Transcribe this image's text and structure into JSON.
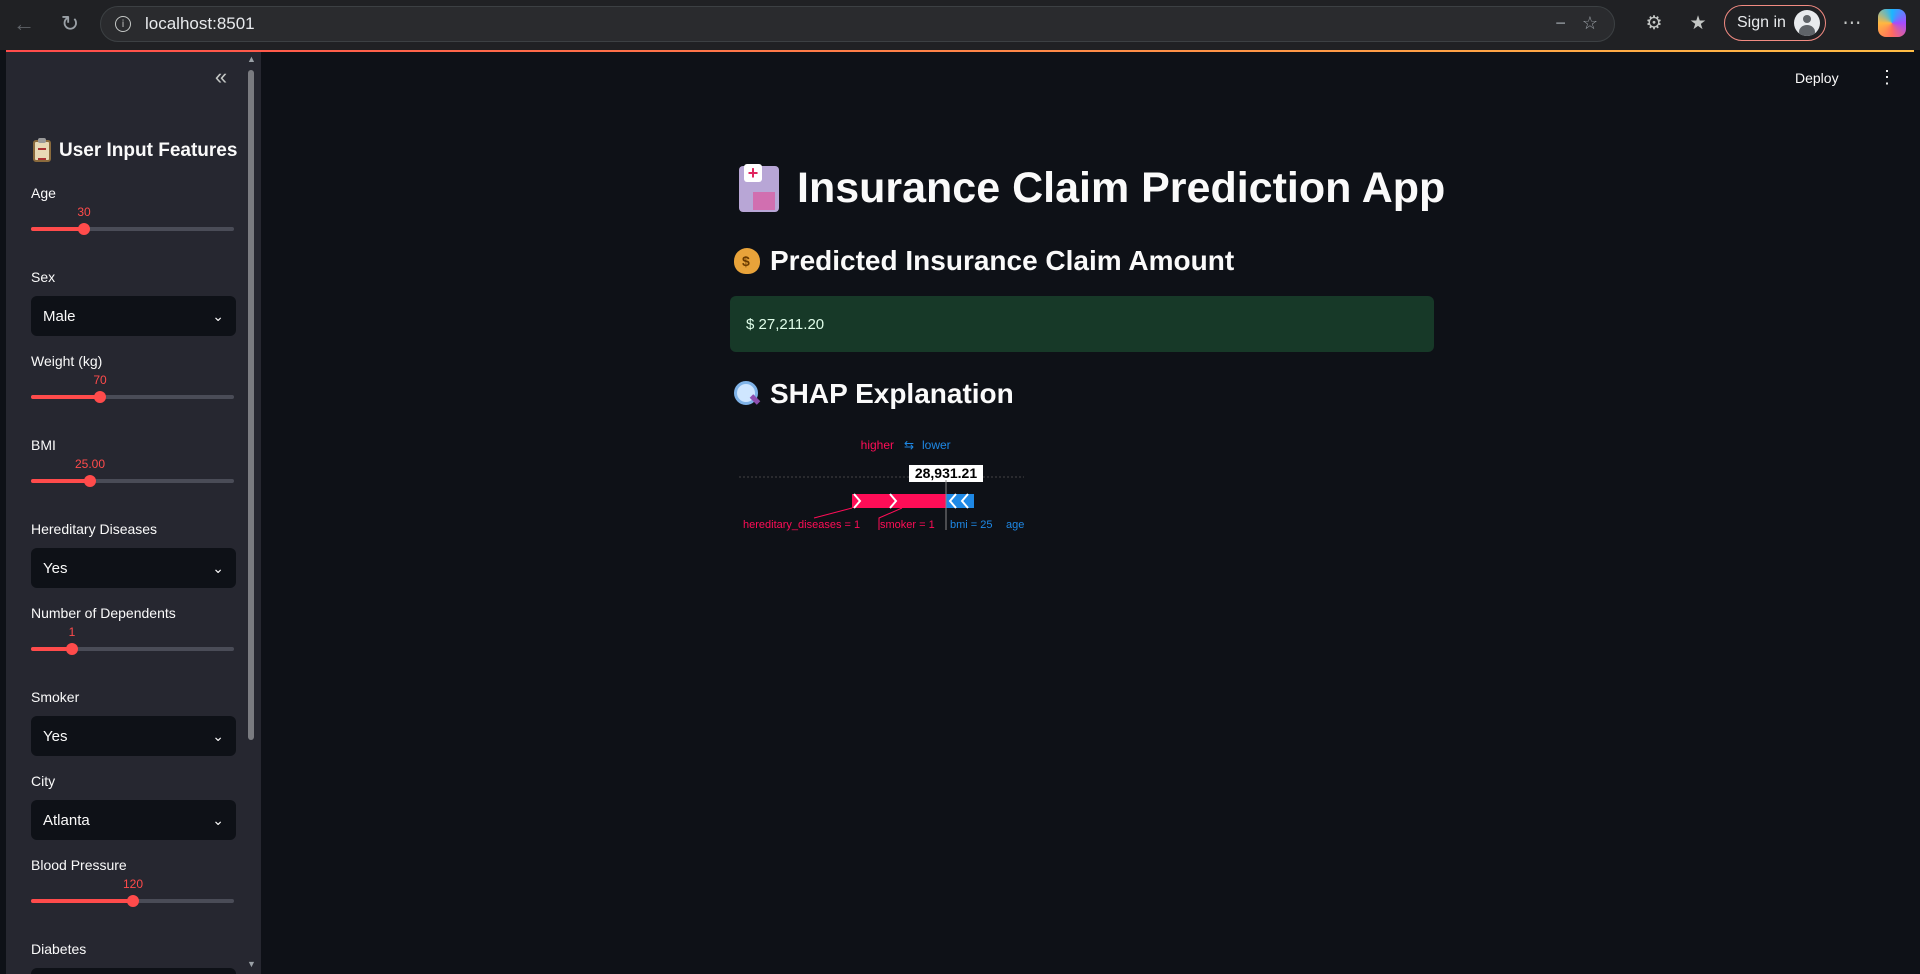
{
  "browser": {
    "url": "localhost:8501",
    "sign_in_label": "Sign in"
  },
  "app": {
    "deploy_label": "Deploy",
    "title": "Insurance Claim Prediction App",
    "prediction_heading": "Predicted Insurance Claim Amount",
    "prediction_value": "$ 27,211.20",
    "shap_heading": "SHAP Explanation"
  },
  "sidebar": {
    "title": "User Input Features",
    "fields": {
      "age": {
        "label": "Age",
        "value": "30",
        "fraction": 0.26
      },
      "sex": {
        "label": "Sex",
        "value": "Male"
      },
      "weight": {
        "label": "Weight (kg)",
        "value": "70",
        "fraction": 0.34
      },
      "bmi": {
        "label": "BMI",
        "value": "25.00",
        "fraction": 0.29
      },
      "hereditary": {
        "label": "Hereditary Diseases",
        "value": "Yes"
      },
      "dependents": {
        "label": "Number of Dependents",
        "value": "1",
        "fraction": 0.2
      },
      "smoker": {
        "label": "Smoker",
        "value": "Yes"
      },
      "city": {
        "label": "City",
        "value": "Atlanta"
      },
      "bp": {
        "label": "Blood Pressure",
        "value": "120",
        "fraction": 0.5
      },
      "diabetes": {
        "label": "Diabetes"
      }
    }
  },
  "shap": {
    "higher_label": "higher",
    "lower_label": "lower",
    "base_value_label": "28,931.21",
    "features": [
      {
        "label": "hereditary_diseases = 1",
        "direction": "higher"
      },
      {
        "label": "smoker = 1",
        "direction": "higher"
      },
      {
        "label": "bmi = 25",
        "direction": "lower"
      },
      {
        "label": "age",
        "direction": "lower"
      }
    ],
    "colors": {
      "higher": "#ff0d57",
      "lower": "#1e88e5"
    }
  },
  "theme": {
    "accent": "#ff4b4b",
    "success_bg": "#173928",
    "bg": "#0e1117",
    "sidebar_bg": "#262730"
  }
}
